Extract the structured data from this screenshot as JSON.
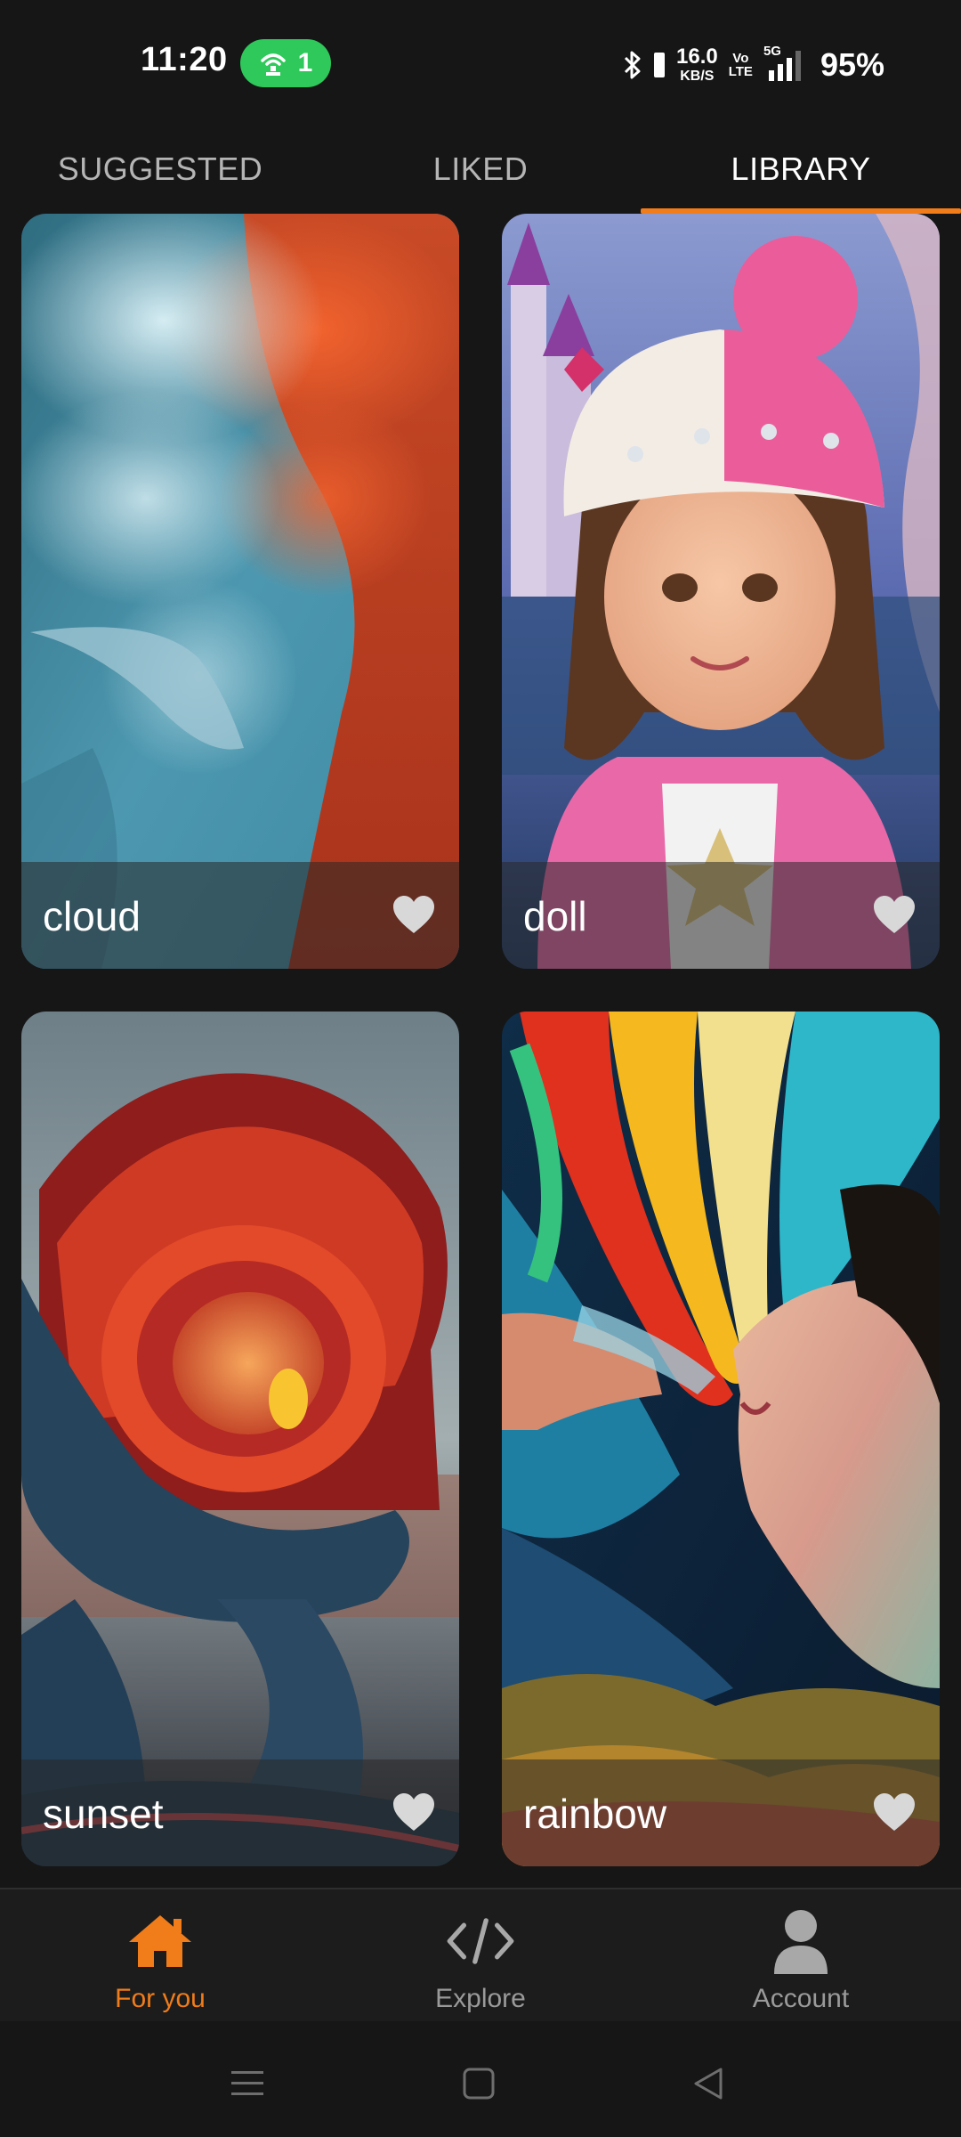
{
  "status_bar": {
    "time": "11:20",
    "hotspot_count": "1",
    "net_speed_value": "16.0",
    "net_speed_unit": "KB/S",
    "volte_top": "Vo",
    "volte_bottom": "LTE",
    "network_type": "5G",
    "battery": "95%"
  },
  "tabs": [
    {
      "label": "SUGGESTED",
      "active": false
    },
    {
      "label": "LIKED",
      "active": false
    },
    {
      "label": "LIBRARY",
      "active": true
    }
  ],
  "cards": [
    {
      "label": "cloud"
    },
    {
      "label": "doll"
    },
    {
      "label": "sunset"
    },
    {
      "label": "rainbow"
    }
  ],
  "bottom_nav": [
    {
      "label": "For you",
      "icon": "home-icon",
      "active": true
    },
    {
      "label": "Explore",
      "icon": "code-icon",
      "active": false
    },
    {
      "label": "Account",
      "icon": "person-icon",
      "active": false
    }
  ],
  "colors": {
    "accent": "#f07c1a",
    "background": "#161616",
    "hotspot": "#2ec95a"
  }
}
